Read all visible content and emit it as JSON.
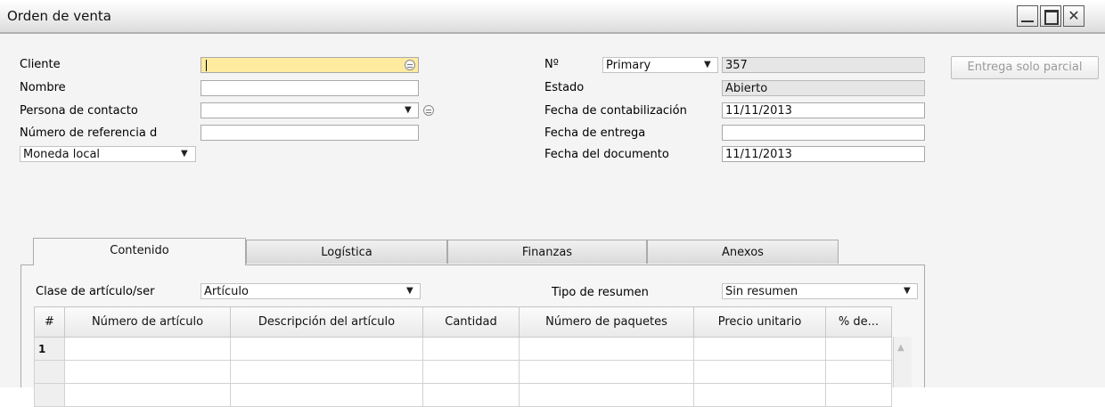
{
  "window": {
    "title": "Orden de venta",
    "controls": {
      "minimize_icon": "minimize-icon",
      "maximize_icon": "maximize-icon",
      "close_glyph": "✕"
    }
  },
  "header_left": {
    "cliente_label": "Cliente",
    "cliente_value": "",
    "nombre_label": "Nombre",
    "nombre_value": "",
    "contacto_label": "Persona de contacto",
    "contacto_value": "",
    "referencia_label": "Número de referencia d",
    "referencia_value": "",
    "moneda_value": "Moneda local"
  },
  "header_right": {
    "numero_label": "Nº",
    "serie_value": "Primary",
    "numero_value": "357",
    "estado_label": "Estado",
    "estado_value": "Abierto",
    "fecha_contab_label": "Fecha de contabilización",
    "fecha_contab_value": "11/11/2013",
    "fecha_entrega_label": "Fecha de entrega",
    "fecha_entrega_value": "",
    "fecha_doc_label": "Fecha del documento",
    "fecha_doc_value": "11/11/2013"
  },
  "side_button": {
    "label": "Entrega solo parcial",
    "enabled": false
  },
  "tabs": [
    {
      "label": "Contenido",
      "active": true
    },
    {
      "label": "Logística",
      "active": false
    },
    {
      "label": "Finanzas",
      "active": false
    },
    {
      "label": "Anexos",
      "active": false
    }
  ],
  "contenido": {
    "clase_label": "Clase de artículo/ser",
    "clase_value": "Artículo",
    "resumen_label": "Tipo de resumen",
    "resumen_value": "Sin resumen",
    "columns": [
      "#",
      "Número de artículo",
      "Descripción del artículo",
      "Cantidad",
      "Número de paquetes",
      "Precio unitario",
      "% de..."
    ],
    "rows": [
      [
        "1",
        "",
        "",
        "",
        "",
        "",
        ""
      ],
      [
        "",
        "",
        "",
        "",
        "",
        "",
        ""
      ],
      [
        "",
        "",
        "",
        "",
        "",
        "",
        ""
      ]
    ]
  },
  "colors": {
    "active_field": "#ffeba0",
    "readonly_field": "#e6e6e6",
    "window_background": "#f4f4f4"
  }
}
